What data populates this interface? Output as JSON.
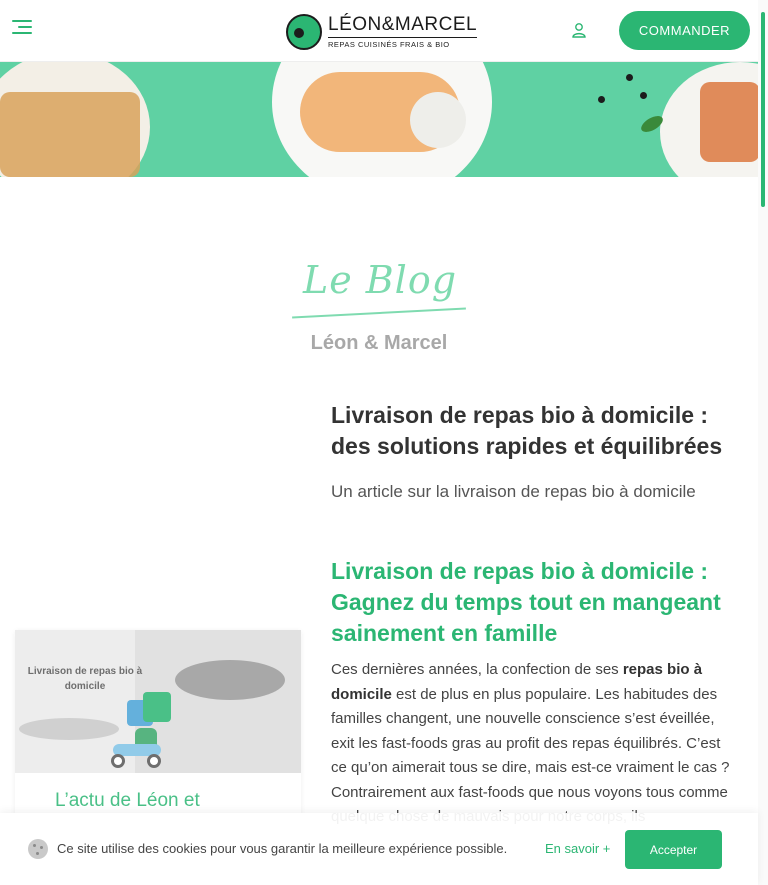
{
  "header": {
    "logo_name": "LÉON&MARCEL",
    "logo_tag": "REPAS CUISINÉS FRAIS & BIO",
    "cta_label": "COMMANDER"
  },
  "blog": {
    "script_title": "Le Blog",
    "subtitle": "Léon & Marcel"
  },
  "article": {
    "title": "Livraison de repas bio à domicile : des solutions rapides et équilibrées",
    "subtitle": "Un article sur la livraison de repas bio à domicile",
    "section_heading": "Livraison de repas bio à domicile : Gagnez du temps tout en mangeant sainement en famille",
    "body_part1": "Ces dernières années, la confection de ses ",
    "body_bold": "repas bio à domicile",
    "body_part2": " est de plus en plus populaire. Les habitudes des familles changent, une nouvelle conscience s’est éveillée, exit les fast-foods gras au profit des repas équilibrés. C’est ce qu’on aimerait tous se dire, mais est-ce vraiment le cas ? Contrairement aux fast-foods que nous voyons tous comme quelque chose de mauvais pour notre corps, ils"
  },
  "sidebar_card": {
    "image_label": "Livraison de repas bio à domicile",
    "title": "L’actu de Léon et"
  },
  "cookie_bar": {
    "text": "Ce site utilise des cookies pour vous garantir la meilleure expérience possible.",
    "more_link": "En savoir +",
    "accept_label": "Accepter"
  },
  "colors": {
    "brand_green": "#2bb673",
    "hero_green": "#5fd1a3",
    "script_green": "#7fdbb0"
  }
}
